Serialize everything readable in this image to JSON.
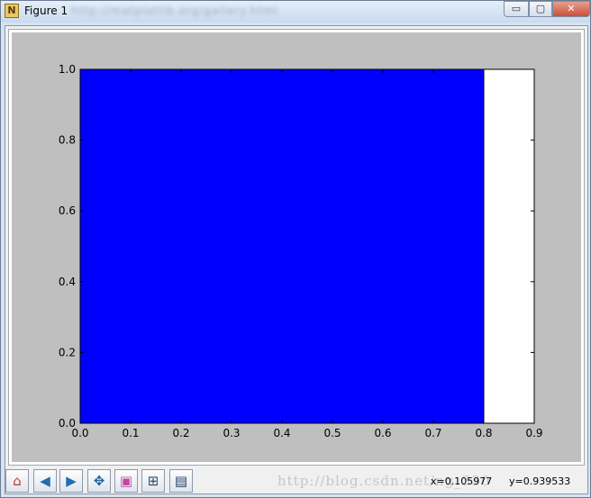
{
  "window": {
    "title": "Figure 1",
    "blurred_url": "http://matplotlib.org/gallery.html",
    "minimize_label": "▭",
    "maximize_label": "▢",
    "close_label": "✕"
  },
  "toolbar": {
    "buttons": [
      {
        "name": "home-icon",
        "glyph": "⌂",
        "color": "#c0392b"
      },
      {
        "name": "back-icon",
        "glyph": "◀",
        "color": "#1f6fb2"
      },
      {
        "name": "forward-icon",
        "glyph": "▶",
        "color": "#1f6fb2"
      },
      {
        "name": "pan-icon",
        "glyph": "✥",
        "color": "#1a5e9a"
      },
      {
        "name": "zoom-icon",
        "glyph": "▣",
        "color": "#c04aa0"
      },
      {
        "name": "subplots-icon",
        "glyph": "⊞",
        "color": "#2c4a6b"
      },
      {
        "name": "save-icon",
        "glyph": "▤",
        "color": "#1c3d63"
      }
    ],
    "x_readout": "x=0.105977",
    "y_readout": "y=0.939533"
  },
  "watermark": "http://blog.csdn.net/ng_330",
  "colors": {
    "bar": "#0000ff",
    "figure_bg": "#bfbfbf",
    "axes_bg": "#ffffff"
  },
  "chart_data": {
    "type": "bar",
    "bars": [
      {
        "x_start": 0.0,
        "x_end": 0.8,
        "height": 1.0,
        "color": "#0000ff"
      }
    ],
    "xlim": [
      0.0,
      0.9
    ],
    "ylim": [
      0.0,
      1.0
    ],
    "xticks": [
      "0.0",
      "0.1",
      "0.2",
      "0.3",
      "0.4",
      "0.5",
      "0.6",
      "0.7",
      "0.8",
      "0.9"
    ],
    "yticks": [
      "0.0",
      "0.2",
      "0.4",
      "0.6",
      "0.8",
      "1.0"
    ],
    "title": "",
    "xlabel": "",
    "ylabel": "",
    "grid": false
  }
}
